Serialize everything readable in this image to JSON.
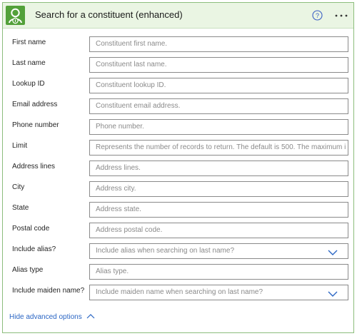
{
  "header": {
    "title": "Search for a constituent (enhanced)",
    "app_icon": "constituent-person-icon",
    "help_icon": "help-circle-icon",
    "more_icon": "more-ellipsis-icon",
    "accent_color": "#53a13a",
    "header_bg": "#eaf5e3"
  },
  "fields": [
    {
      "label": "First name",
      "placeholder": "Constituent first name."
    },
    {
      "label": "Last name",
      "placeholder": "Constituent last name."
    },
    {
      "label": "Lookup ID",
      "placeholder": "Constituent lookup ID."
    },
    {
      "label": "Email address",
      "placeholder": "Constituent email address."
    },
    {
      "label": "Phone number",
      "placeholder": "Phone number."
    },
    {
      "label": "Limit",
      "placeholder": "Represents the number of records to return. The default is 500. The maximum i"
    },
    {
      "label": "Address lines",
      "placeholder": "Address lines."
    },
    {
      "label": "City",
      "placeholder": "Address city."
    },
    {
      "label": "State",
      "placeholder": "Address state."
    },
    {
      "label": "Postal code",
      "placeholder": "Address postal code."
    },
    {
      "label": "Include alias?",
      "placeholder": "Include alias when searching on last name?",
      "dropdown": true
    },
    {
      "label": "Alias type",
      "placeholder": "Alias type."
    },
    {
      "label": "Include maiden name?",
      "placeholder": "Include maiden name when searching on last name?",
      "dropdown": true
    }
  ],
  "footer": {
    "toggle_label": "Hide advanced options",
    "link_color": "#2b66c4"
  }
}
